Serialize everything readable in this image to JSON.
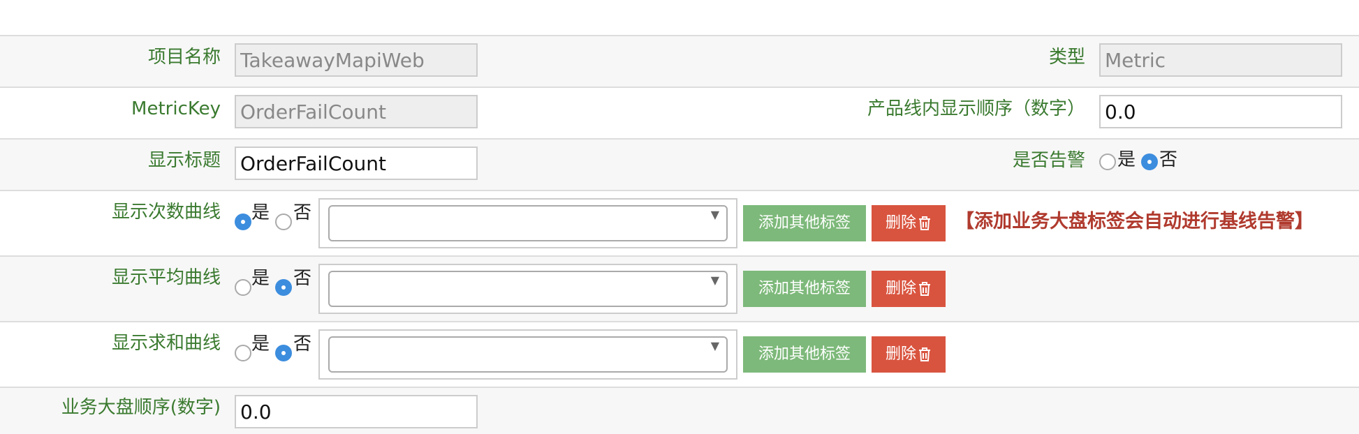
{
  "form": {
    "project_name": {
      "label": "项目名称",
      "value": "TakeawayMapiWeb"
    },
    "type": {
      "label": "类型",
      "value": "Metric"
    },
    "metric_key": {
      "label": "MetricKey",
      "value": "OrderFailCount"
    },
    "display_order": {
      "label": "产品线内显示顺序（数字）",
      "value": "0.0"
    },
    "display_title": {
      "label": "显示标题",
      "value": "OrderFailCount"
    },
    "alert": {
      "label": "是否告警",
      "yes": "是",
      "no": "否",
      "selected": "否"
    },
    "count_curve": {
      "label": "显示次数曲线",
      "yes": "是",
      "no": "否",
      "selected": "是"
    },
    "avg_curve": {
      "label": "显示平均曲线",
      "yes": "是",
      "no": "否",
      "selected": "否"
    },
    "sum_curve": {
      "label": "显示求和曲线",
      "yes": "是",
      "no": "否",
      "selected": "否"
    },
    "dashboard_order": {
      "label": "业务大盘顺序(数字)",
      "value": "0.0"
    }
  },
  "buttons": {
    "add_tag": "添加其他标签",
    "delete": "删除"
  },
  "warning_text": "【添加业务大盘标签会自动进行基线告警】",
  "colors": {
    "label_green": "#3a7a2f",
    "add_button": "#7db97a",
    "delete_button": "#d9543f",
    "warning_red": "#b03a2e",
    "radio_selected": "#3c8dde"
  },
  "icons": {
    "dropdown": "caret-down-icon",
    "delete": "trash-icon"
  }
}
